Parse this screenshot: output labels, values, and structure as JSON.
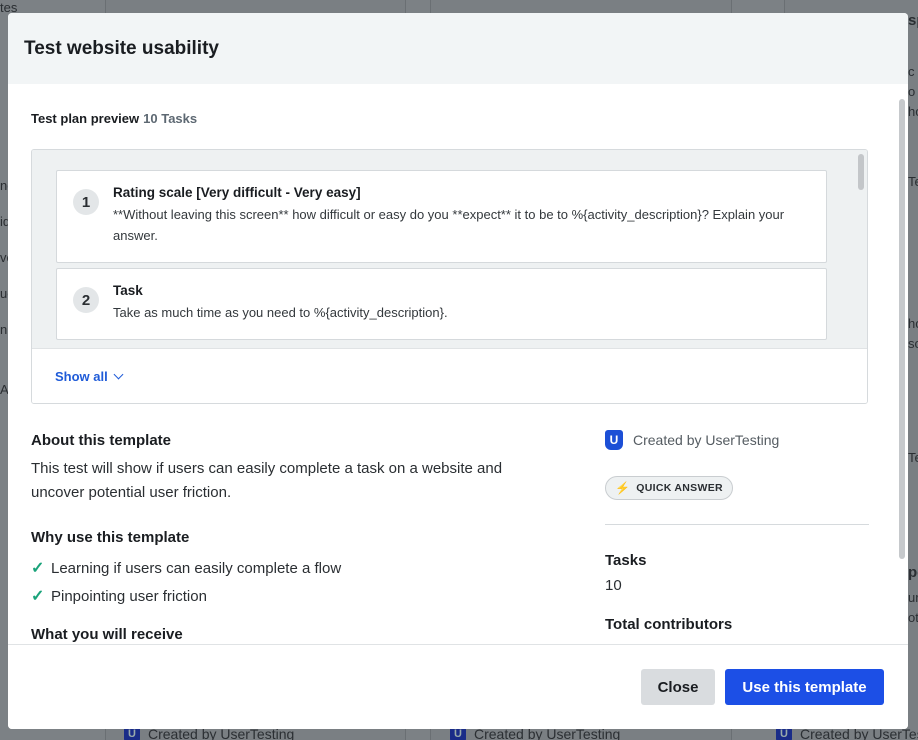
{
  "background": {
    "left_snippets": [
      "tes",
      "ne",
      "ide",
      "ve",
      "uc",
      "n",
      "AT"
    ],
    "right_snippets": [
      "sp",
      "c",
      "o",
      "ho",
      "Te",
      "ho",
      "so",
      "Te",
      "pe",
      "ur",
      "ot"
    ],
    "footer_label": "Created by UserTesting",
    "footer_logo_letter": "U"
  },
  "modal": {
    "title": "Test website usability",
    "plan": {
      "label": "Test plan preview",
      "count": "10 Tasks",
      "tasks": [
        {
          "number": "1",
          "title": "Rating scale [Very difficult - Very easy]",
          "description": "**Without leaving this screen** how difficult or easy do you **expect** it to be to %{activity_description}? Explain your answer."
        },
        {
          "number": "2",
          "title": "Task",
          "description": "Take as much time as you need to %{activity_description}."
        }
      ],
      "show_all_label": "Show all"
    },
    "about": {
      "title": "About this template",
      "text": "This test will show if users can easily complete a task on a website and uncover potential user friction."
    },
    "why": {
      "title": "Why use this template",
      "items": [
        "Learning if users can easily complete a flow",
        "Pinpointing user friction"
      ],
      "check_icon": "checkmark-icon"
    },
    "next_section_title": "What you will receive",
    "creator": {
      "logo_letter": "U",
      "label": "Created by UserTesting"
    },
    "badge": {
      "icon": "lightning-icon",
      "label": "QUICK ANSWER"
    },
    "stats": [
      {
        "label": "Tasks",
        "value": "10"
      },
      {
        "label": "Total contributors",
        "value": ""
      }
    ],
    "footer": {
      "close_label": "Close",
      "use_label": "Use this template"
    },
    "colors": {
      "primary": "#1c4fe6",
      "link": "#1f5bd8",
      "check": "#1aa37a"
    }
  }
}
